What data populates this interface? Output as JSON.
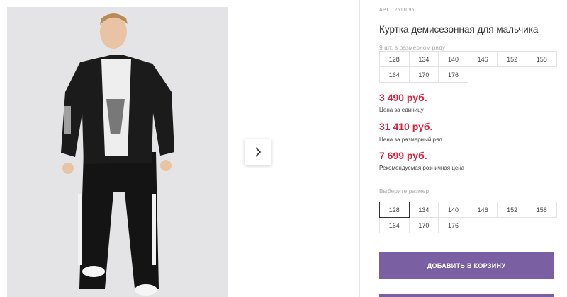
{
  "product": {
    "article": "АРТ. 12511095",
    "title": "Куртка демисезонная для мальчика",
    "row_count": "9 шт. в размерном ряду",
    "row_sizes": [
      "128",
      "134",
      "140",
      "146",
      "152",
      "158",
      "164",
      "170",
      "176"
    ],
    "prices": [
      {
        "value": "3 490 руб.",
        "label": "Цена за единицу"
      },
      {
        "value": "31 410 руб.",
        "label": "Цена за размерный ряд"
      },
      {
        "value": "7 699 руб.",
        "label": "Рекомендуемая розничная цена"
      }
    ],
    "choose_label": "Выберите размер:",
    "choose_sizes": [
      "128",
      "134",
      "140",
      "146",
      "152",
      "158",
      "164",
      "170",
      "176"
    ],
    "selected_size": "128",
    "add_to_cart": "ДОБАВИТЬ В КОРЗИНУ"
  },
  "colors": {
    "price": "#d4213d",
    "button": "#7b5fa3"
  },
  "icons": {
    "gallery_next": "chevron-right-icon"
  }
}
